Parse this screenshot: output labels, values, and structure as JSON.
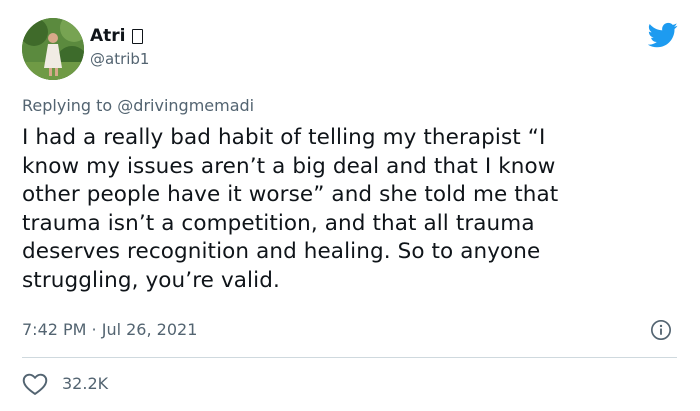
{
  "author": {
    "display_name": "Atri",
    "handle": "@atrib1",
    "avatar_icon": "user-photo"
  },
  "reply": {
    "prefix": "Replying to",
    "mention": "@drivingmemadi"
  },
  "tweet": {
    "lines": [
      "I had a really bad habit of telling my therapist “I",
      "know my issues aren’t a big deal and that I know",
      "other people have it worse” and she told me that",
      "trauma isn’t a competition, and that all trauma",
      "deserves recognition and healing. So to anyone",
      "struggling, you’re valid."
    ],
    "timestamp": "7:42 PM · Jul 26, 2021"
  },
  "engagement": {
    "likes": "32.2K"
  },
  "colors": {
    "brand": "#1d9bf0",
    "secondary_text": "#536471",
    "divider": "#cfd9de"
  }
}
